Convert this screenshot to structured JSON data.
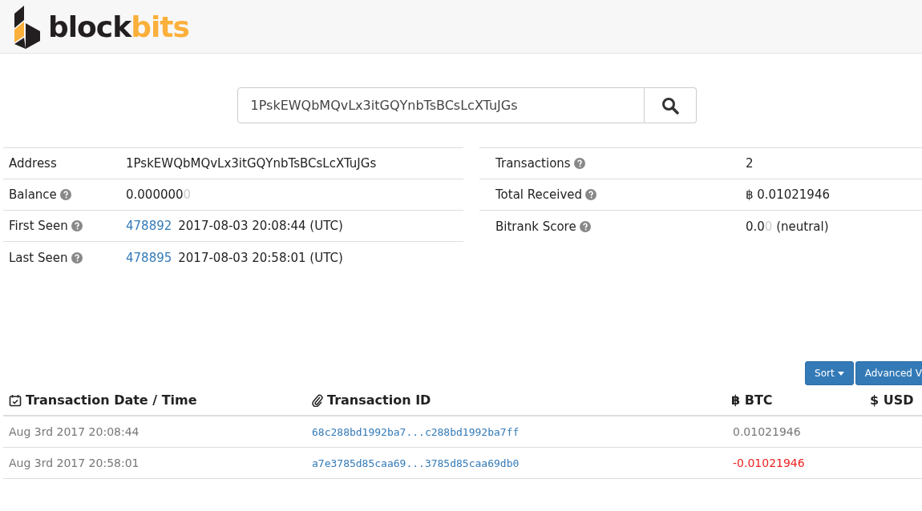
{
  "logo": {
    "dark": "block",
    "accent": "bits"
  },
  "search": {
    "value": "1PskEWQbMQvLx3itGQYnbTsBCsLcXTuJGs"
  },
  "left_info": [
    {
      "label": "Address",
      "help": false,
      "value": "1PskEWQbMQvLx3itGQYnbTsBCsLcXTuJGs"
    },
    {
      "label": "Balance",
      "help": true,
      "value": "0.000000",
      "faded": "0"
    },
    {
      "label": "First Seen",
      "help": true,
      "block": "478892",
      "value": "2017-08-03 20:08:44 (UTC)"
    },
    {
      "label": "Last Seen",
      "help": true,
      "block": "478895",
      "value": "2017-08-03 20:58:01 (UTC)"
    }
  ],
  "right_info": [
    {
      "label": "Transactions",
      "help": true,
      "value": "2"
    },
    {
      "label": "Total Received",
      "help": true,
      "value": "฿ 0.01021946"
    },
    {
      "label": "Bitrank Score",
      "help": true,
      "value": "0.0",
      "faded": "0",
      "suffix": " (neutral)"
    }
  ],
  "buttons": [
    {
      "label": "Sort",
      "caret": true
    },
    {
      "label": "Advanced V",
      "caret": false
    }
  ],
  "table": {
    "columns": [
      {
        "label": "Transaction Date / Time"
      },
      {
        "label": "Transaction ID"
      },
      {
        "label": "฿ BTC"
      },
      {
        "label": "$ USD"
      }
    ],
    "rows": [
      {
        "date": "Aug 3rd 2017 20:08:44",
        "txid": "68c288bd1992ba7...c288bd1992ba7ff",
        "btc": "0.01021946",
        "negative": false
      },
      {
        "date": "Aug 3rd 2017 20:58:01",
        "txid": "a7e3785d85caa69...3785d85caa69db0",
        "btc": "-0.01021946",
        "negative": true
      }
    ]
  }
}
